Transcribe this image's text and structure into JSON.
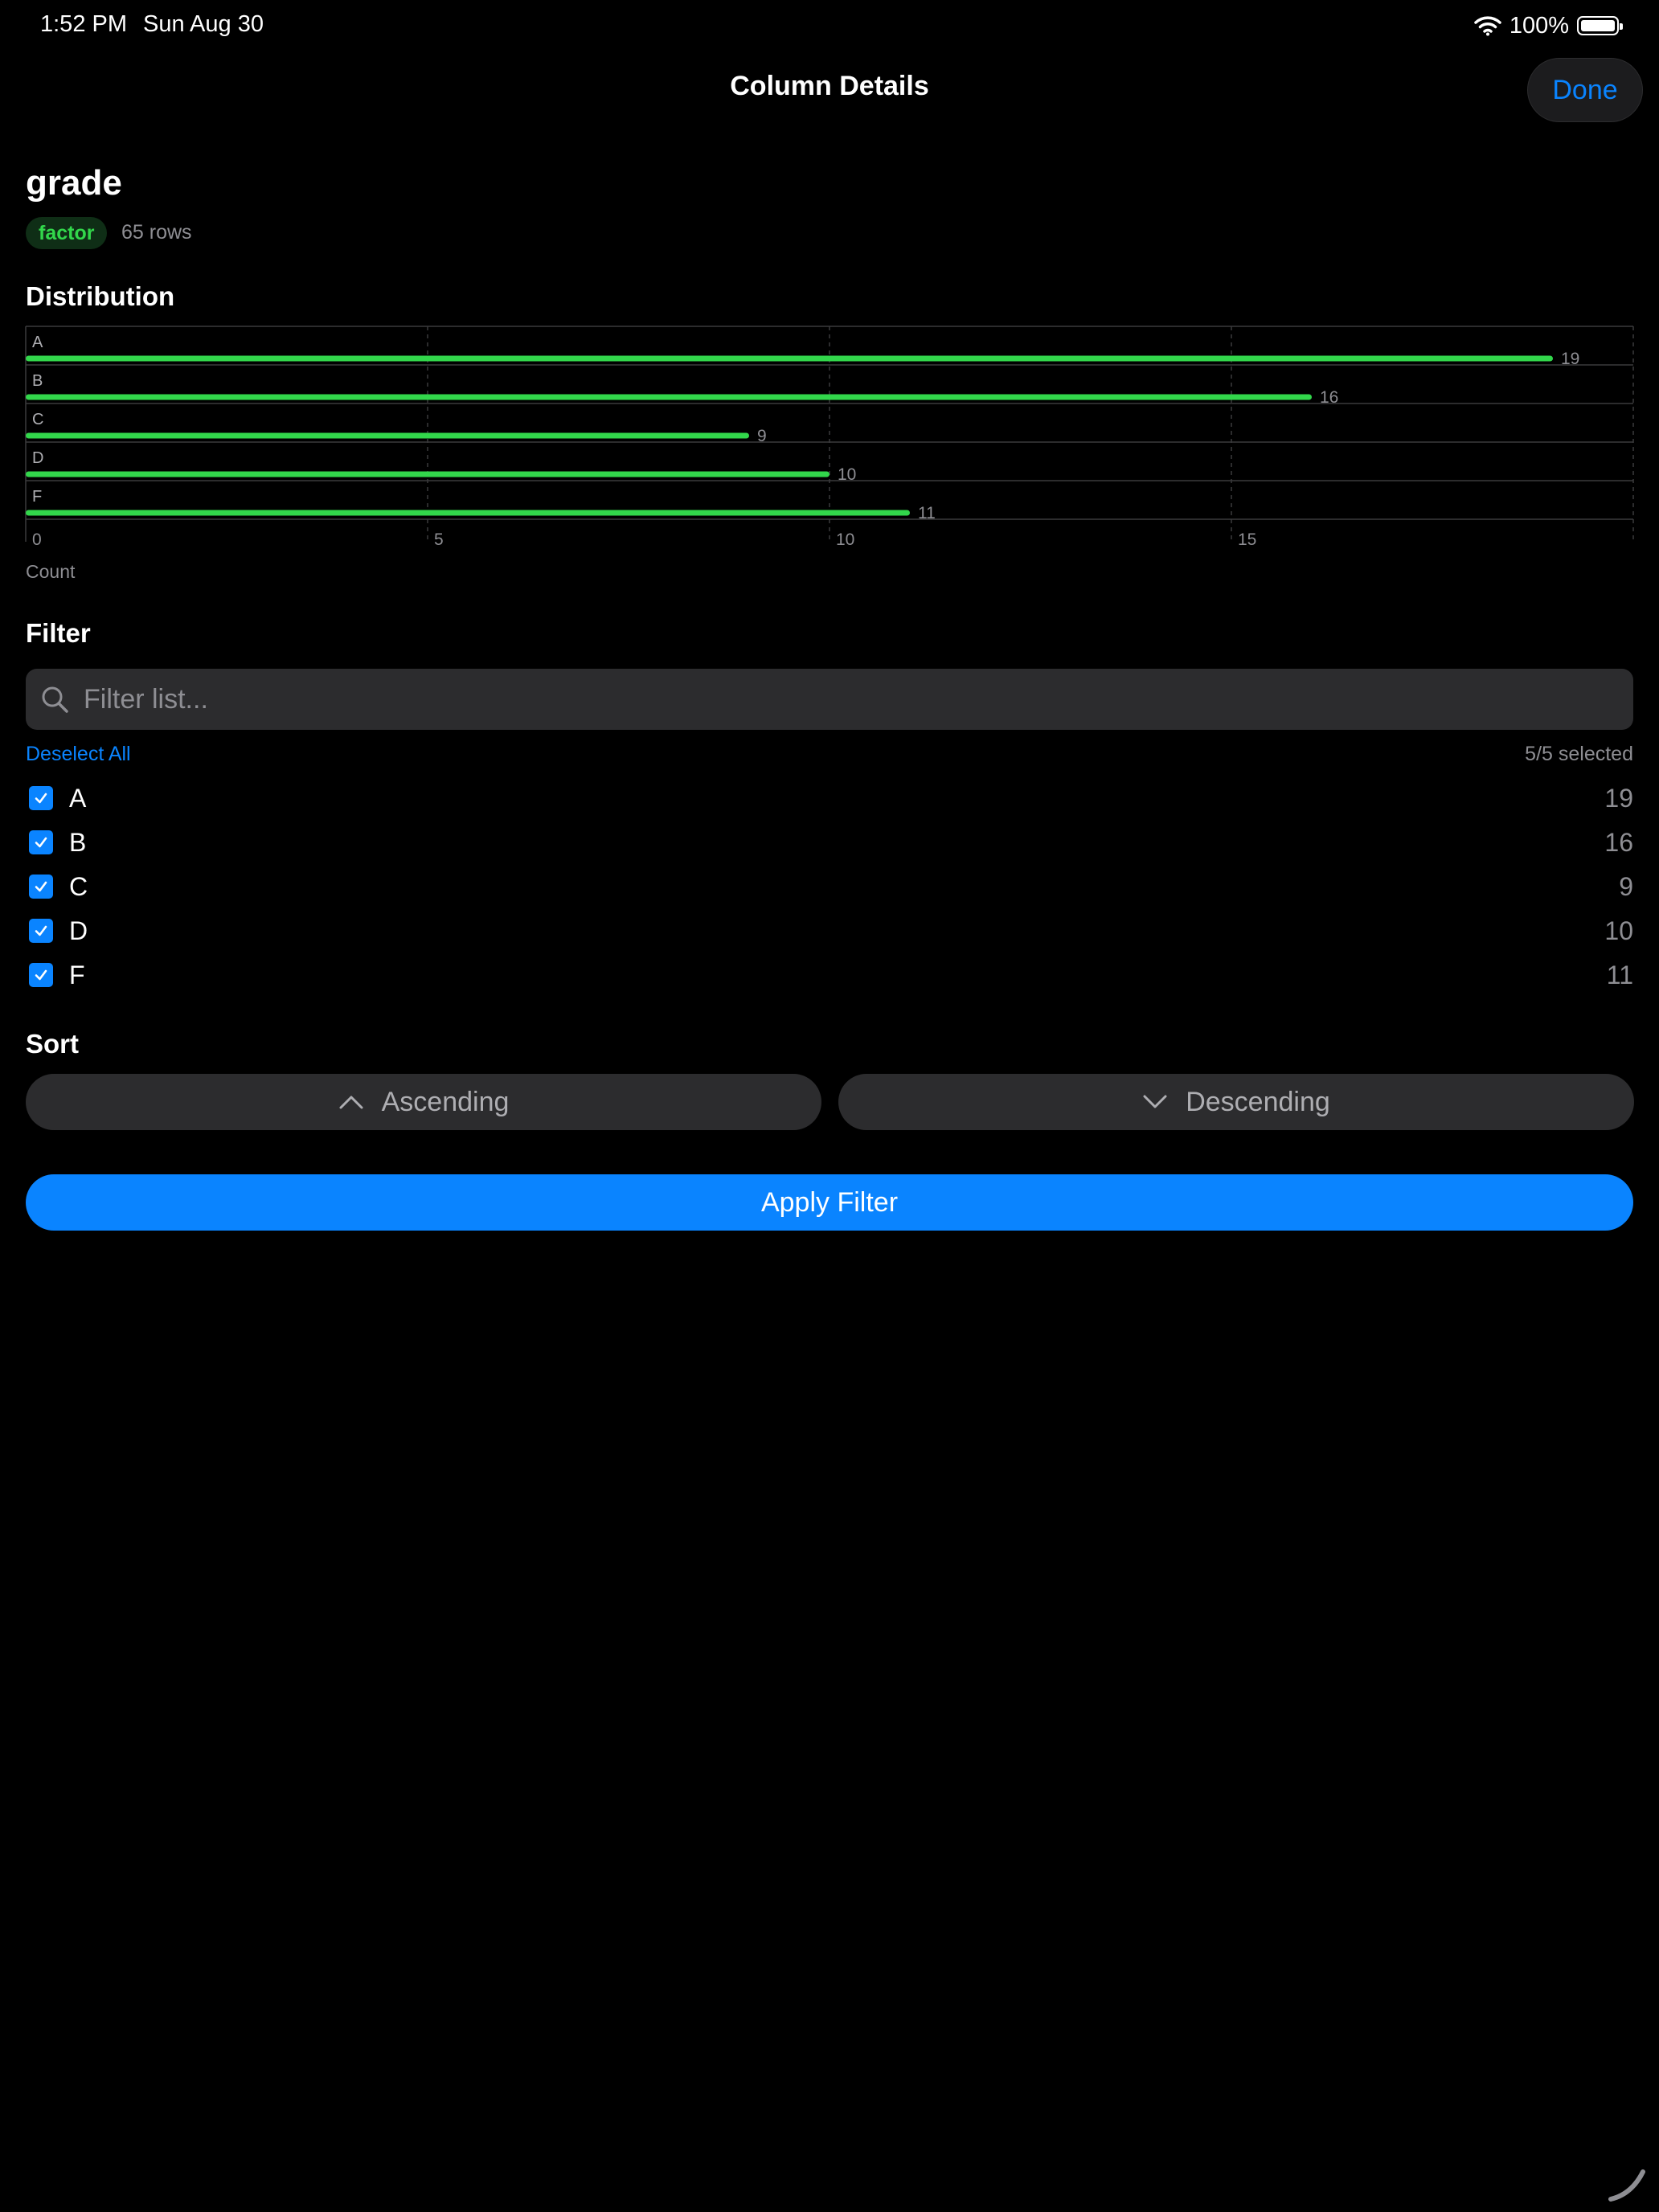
{
  "status_bar": {
    "time": "1:52 PM",
    "date": "Sun Aug 30",
    "battery": "100%"
  },
  "header": {
    "title": "Column Details",
    "done_label": "Done"
  },
  "column": {
    "name": "grade",
    "type": "factor",
    "row_count": "65 rows"
  },
  "distribution": {
    "title": "Distribution",
    "axis_label": "Count"
  },
  "chart_data": {
    "type": "bar",
    "orientation": "horizontal",
    "categories": [
      "A",
      "B",
      "C",
      "D",
      "F"
    ],
    "values": [
      19,
      16,
      9,
      10,
      11
    ],
    "xlabel": "Count",
    "xlim": [
      0,
      20
    ],
    "xticks": [
      0,
      5,
      10,
      15
    ],
    "grid": true,
    "bar_color": "#32d74b"
  },
  "filter": {
    "title": "Filter",
    "placeholder": "Filter list...",
    "deselect_label": "Deselect All",
    "selected_count": "5/5 selected",
    "options": [
      {
        "label": "A",
        "count": "19",
        "checked": true
      },
      {
        "label": "B",
        "count": "16",
        "checked": true
      },
      {
        "label": "C",
        "count": "9",
        "checked": true
      },
      {
        "label": "D",
        "count": "10",
        "checked": true
      },
      {
        "label": "F",
        "count": "11",
        "checked": true
      }
    ]
  },
  "sort": {
    "title": "Sort",
    "ascending_label": "Ascending",
    "descending_label": "Descending"
  },
  "apply_label": "Apply Filter",
  "colors": {
    "accent": "#0a84ff",
    "green": "#32d74b",
    "background": "#000000",
    "control": "#2c2c2e"
  },
  "icons": [
    "wifi-icon",
    "battery-icon",
    "search-icon",
    "checkmark-icon",
    "chevron-up-icon",
    "chevron-down-icon"
  ]
}
